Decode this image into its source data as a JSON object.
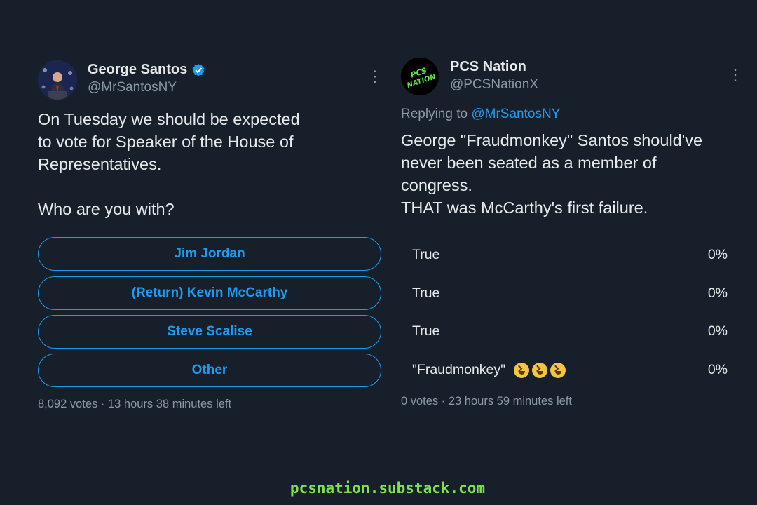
{
  "left_tweet": {
    "name": "George Santos",
    "handle": "@MrSantosNY",
    "verified": true,
    "text": "On Tuesday we should be  expected\nto vote for Speaker of the House of\nRepresentatives.\n\nWho are you with?",
    "poll_options": [
      "Jim Jordan",
      "(Return) Kevin McCarthy",
      "Steve Scalise",
      "Other"
    ],
    "votes_info": "8,092 votes · 13 hours 38 minutes left",
    "more_icon": "more-vertical-icon"
  },
  "right_tweet": {
    "name": "PCS Nation",
    "handle": "@PCSNationX",
    "avatar_text": "PCS NATION",
    "replying_prefix": "Replying to ",
    "replying_to": "@MrSantosNY",
    "text": "George \"Fraudmonkey\" Santos should've\nnever been seated as a member of\ncongress.\nTHAT was McCarthy's first failure.",
    "poll_results": [
      {
        "label": "True",
        "pct": "0%"
      },
      {
        "label": "True",
        "pct": "0%"
      },
      {
        "label": "True",
        "pct": "0%"
      },
      {
        "label": "\"Fraudmonkey\"",
        "pct": "0%",
        "emoji": "grinning-squinting-face x3"
      }
    ],
    "votes_info": "0 votes · 23 hours 59 minutes left",
    "more_icon": "more-vertical-icon"
  },
  "footer": "pcsnation.substack.com",
  "colors": {
    "background": "#17202a",
    "accent": "#1d9bf0",
    "muted": "#8b98a5",
    "footer": "#7ee04a"
  }
}
